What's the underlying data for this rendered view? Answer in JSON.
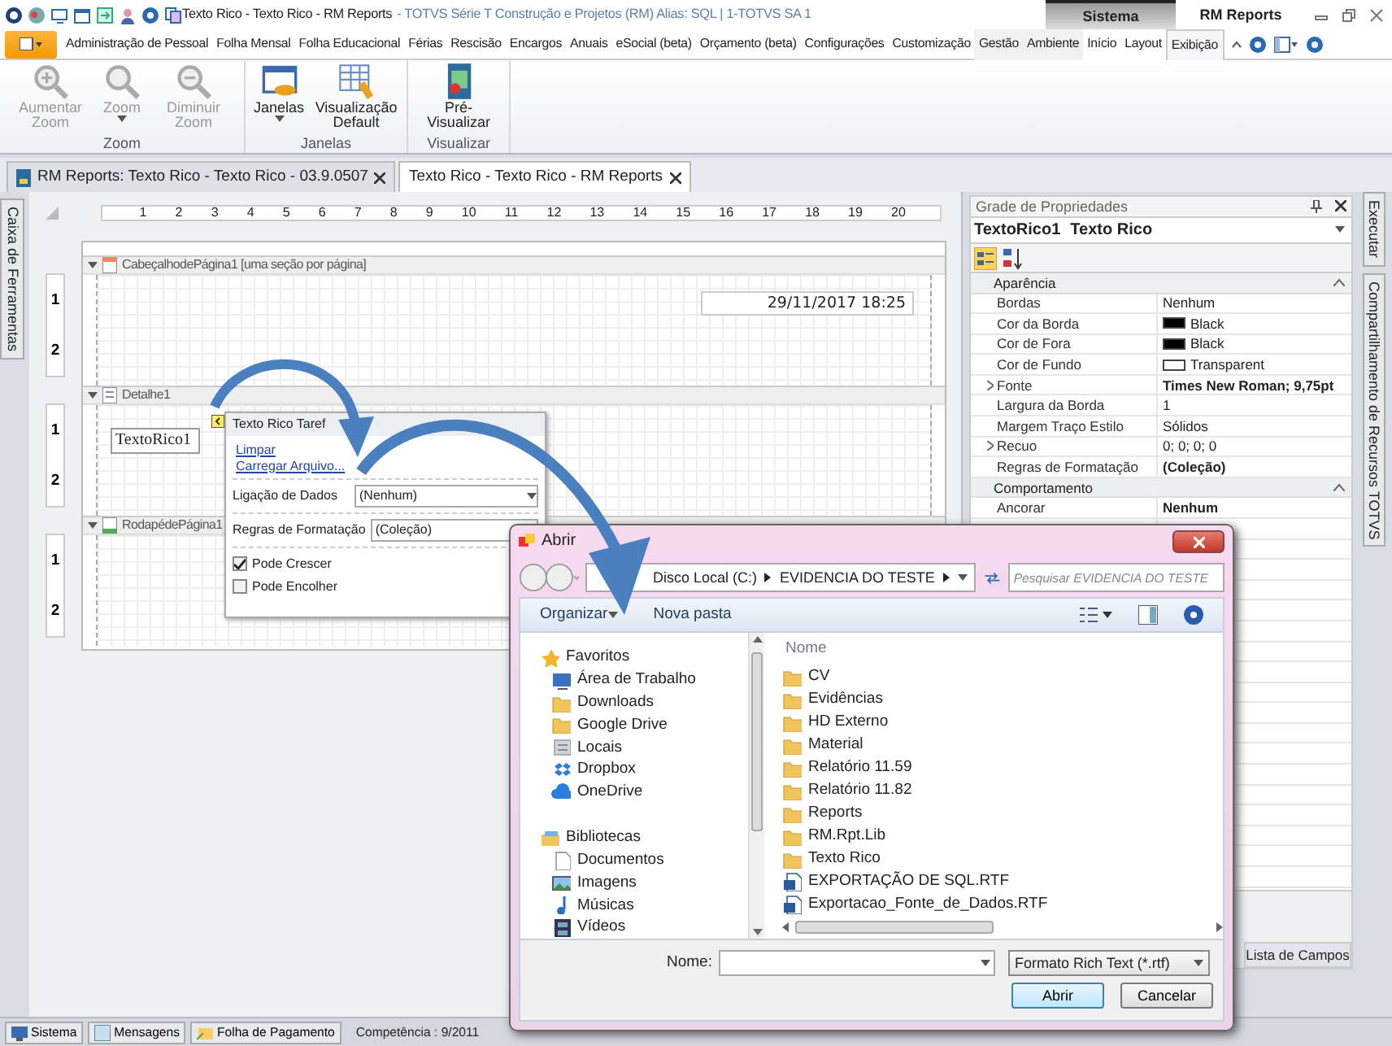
{
  "title_bar": {
    "title": "Texto Rico - Texto Rico - RM Reports",
    "subtitle": "- TOTVS Série T Construção e Projetos (RM) Alias: SQL | 1-TOTVS SA 1"
  },
  "menu_tabs": [
    {
      "label": "Administração de Pessoal",
      "selected": false
    },
    {
      "label": "Folha Mensal",
      "selected": false
    },
    {
      "label": "Folha Educacional",
      "selected": false
    },
    {
      "label": "Férias",
      "selected": false
    },
    {
      "label": "Rescisão",
      "selected": false
    },
    {
      "label": "Encargos",
      "selected": false
    },
    {
      "label": "Anuais",
      "selected": false
    },
    {
      "label": "eSocial (beta)",
      "selected": false
    },
    {
      "label": "Orçamento (beta)",
      "selected": false
    },
    {
      "label": "Configurações",
      "selected": false
    },
    {
      "label": "Customização",
      "selected": false
    }
  ],
  "context_groups": [
    {
      "label": "Sistema",
      "kind": "dark",
      "tabs": [
        {
          "label": "Gestão",
          "selected": false
        },
        {
          "label": "Ambiente",
          "selected": false
        }
      ]
    },
    {
      "label": "RM Reports",
      "kind": "light",
      "tabs": [
        {
          "label": "Início",
          "selected": false
        },
        {
          "label": "Layout",
          "selected": false
        },
        {
          "label": "Exibição",
          "selected": true
        }
      ]
    }
  ],
  "ribbon_groups": [
    {
      "label": "Zoom",
      "buttons": [
        {
          "label": "Aumentar Zoom",
          "disabled": true,
          "dropdown": false
        },
        {
          "label": "Zoom",
          "disabled": true,
          "dropdown": true
        },
        {
          "label": "Diminuir Zoom",
          "disabled": true,
          "dropdown": false
        }
      ]
    },
    {
      "label": "Janelas",
      "buttons": [
        {
          "label": "Janelas",
          "disabled": false,
          "dropdown": true
        },
        {
          "label": "Visualização Default",
          "disabled": false,
          "dropdown": false
        }
      ]
    },
    {
      "label": "Visualizar",
      "buttons": [
        {
          "label": "Pré-Visualizar",
          "disabled": false,
          "dropdown": false
        }
      ]
    }
  ],
  "doc_tabs": [
    {
      "label": "RM Reports: Texto Rico - Texto Rico - 03.9.0507",
      "selected": false
    },
    {
      "label": "Texto Rico - Texto Rico - RM Reports",
      "selected": true
    }
  ],
  "left_dock": {
    "label": "Caixa de Ferramentas"
  },
  "designer": {
    "ruler": [
      "1",
      "2",
      "3",
      "4",
      "5",
      "6",
      "7",
      "8",
      "9",
      "10",
      "11",
      "12",
      "13",
      "14",
      "15",
      "16",
      "17",
      "18",
      "19",
      "20"
    ],
    "bands": [
      {
        "name": "CabeçalhodePágina1 [uma seção por página]",
        "kind": "header",
        "ruler": [
          "1",
          "2"
        ],
        "field": "29/11/2017 18:25"
      },
      {
        "name": "Detalhe1",
        "kind": "detail",
        "ruler": [
          "1",
          "2"
        ],
        "field": "TextoRico1"
      },
      {
        "name": "RodapédePágina1",
        "kind": "footer",
        "ruler": [
          "1",
          "2"
        ]
      }
    ]
  },
  "smart_tag": {
    "title": "Texto Rico Taref",
    "actions": [
      "Limpar",
      "Carregar Arquivo..."
    ],
    "fields": [
      {
        "label": "Ligação de Dados",
        "value": "(Nenhum)",
        "kind": "combo"
      },
      {
        "label": "Regras de Formatação",
        "value": "(Coleção)",
        "kind": "text"
      }
    ],
    "checks": [
      {
        "label": "Pode Crescer",
        "checked": true
      },
      {
        "label": "Pode Encolher",
        "checked": false
      }
    ]
  },
  "properties": {
    "title": "Grade de Propriedades",
    "object": "TextoRico1",
    "object_type": "Texto Rico",
    "categories": [
      {
        "name": "Aparência",
        "expanded": true,
        "rows": [
          {
            "name": "Bordas",
            "value": "Nenhum",
            "bold": false,
            "expandable": false
          },
          {
            "name": "Cor da Borda",
            "value": "Black",
            "bold": false,
            "expandable": false,
            "color": "#000000"
          },
          {
            "name": "Cor de Fora",
            "value": "Black",
            "bold": false,
            "expandable": false,
            "color": "#000000"
          },
          {
            "name": "Cor de Fundo",
            "value": "Transparent",
            "bold": false,
            "expandable": false,
            "color": "#ffffff"
          },
          {
            "name": "Fonte",
            "value": "Times New Roman; 9,75pt",
            "bold": true,
            "expandable": true
          },
          {
            "name": "Largura da Borda",
            "value": "1",
            "bold": false,
            "expandable": false
          },
          {
            "name": "Margem Traço Estilo",
            "value": "Sólidos",
            "bold": false,
            "expandable": false
          },
          {
            "name": "Recuo",
            "value": "0; 0; 0; 0",
            "bold": false,
            "expandable": true
          },
          {
            "name": "Regras de Formatação",
            "value": "(Coleção)",
            "bold": true,
            "expandable": false
          }
        ]
      },
      {
        "name": "Comportamento",
        "expanded": true,
        "rows": [
          {
            "name": "Ancorar",
            "value": "Nenhum",
            "bold": true,
            "expandable": false
          }
        ]
      }
    ],
    "bottom_tab": "Lista de Campos"
  },
  "right_dock": [
    "Executar",
    "Compartilhamento de Recursos TOTVS"
  ],
  "status_bar": {
    "buttons": [
      "Sistema",
      "Mensagens",
      "Folha de Pagamento"
    ],
    "competencia": "Competência : 9/2011"
  },
  "dialog": {
    "title": "Abrir",
    "path": [
      "Disco Local (C:)",
      "EVIDENCIA DO TESTE"
    ],
    "search_placeholder": "Pesquisar EVIDENCIA DO TESTE",
    "toolbar": [
      "Organizar",
      "Nova pasta"
    ],
    "nav": [
      {
        "label": "Favoritos",
        "children": [
          {
            "label": "Área de Trabalho"
          },
          {
            "label": "Downloads"
          },
          {
            "label": "Google Drive"
          },
          {
            "label": "Locais"
          },
          {
            "label": "Dropbox"
          },
          {
            "label": "OneDrive"
          }
        ]
      },
      {
        "label": "Bibliotecas",
        "children": [
          {
            "label": "Documentos"
          },
          {
            "label": "Imagens"
          },
          {
            "label": "Músicas"
          },
          {
            "label": "Vídeos"
          }
        ]
      }
    ],
    "column": "Nome",
    "files": [
      {
        "name": "CV",
        "kind": "folder"
      },
      {
        "name": "Evidências",
        "kind": "folder"
      },
      {
        "name": "HD Externo",
        "kind": "folder"
      },
      {
        "name": "Material",
        "kind": "folder"
      },
      {
        "name": "Relatório 11.59",
        "kind": "folder"
      },
      {
        "name": "Relatório 11.82",
        "kind": "folder"
      },
      {
        "name": "Reports",
        "kind": "folder"
      },
      {
        "name": "RM.Rpt.Lib",
        "kind": "folder"
      },
      {
        "name": "Texto Rico",
        "kind": "folder"
      },
      {
        "name": "EXPORTAÇÃO DE SQL.RTF",
        "kind": "rtf"
      },
      {
        "name": "Exportacao_Fonte_de_Dados.RTF",
        "kind": "rtf"
      }
    ],
    "filename_label": "Nome:",
    "filter": "Formato Rich Text (*.rtf)",
    "buttons": [
      "Abrir",
      "Cancelar"
    ]
  }
}
